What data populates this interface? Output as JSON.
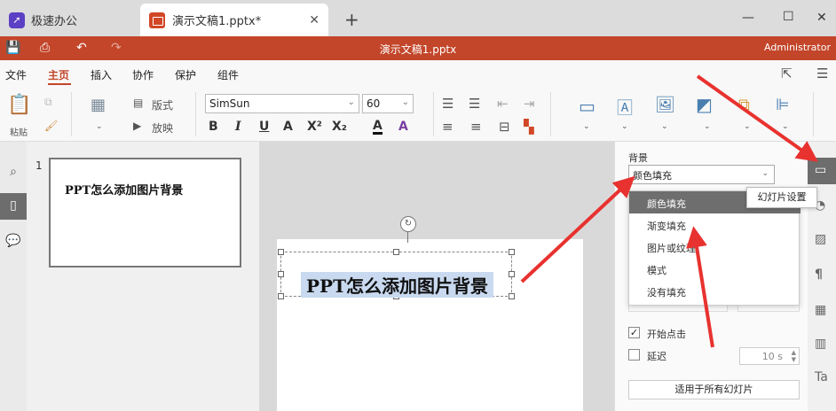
{
  "tabs": {
    "app_title": "极速办公",
    "doc_tab": "演示文稿1.pptx*"
  },
  "window": {
    "doc_title": "演示文稿1.pptx",
    "user": "Administrator"
  },
  "menu": {
    "items": [
      "文件",
      "主页",
      "插入",
      "协作",
      "保护",
      "组件"
    ],
    "active": "主页"
  },
  "ribbon": {
    "paste": "粘贴",
    "layout": "版式",
    "slideshow": "放映",
    "font": "SimSun",
    "font_size": "60"
  },
  "slides": {
    "number": "1",
    "thumb_title": "PPT怎么添加图片背景"
  },
  "slide": {
    "title": "PPT怎么添加图片背景"
  },
  "panel": {
    "bg_label": "背景",
    "bg_value": "颜色填充",
    "options": [
      "颜色填充",
      "渐变填充",
      "图片或纹理",
      "模式",
      "没有填充"
    ],
    "start_click": "开始点击",
    "delay": "延迟",
    "delay_value": "10 s",
    "apply_all": "适用于所有幻灯片"
  },
  "tooltip": "幻灯片设置",
  "colors": {
    "accent": "#c3462a",
    "arrow": "#e8322f"
  }
}
